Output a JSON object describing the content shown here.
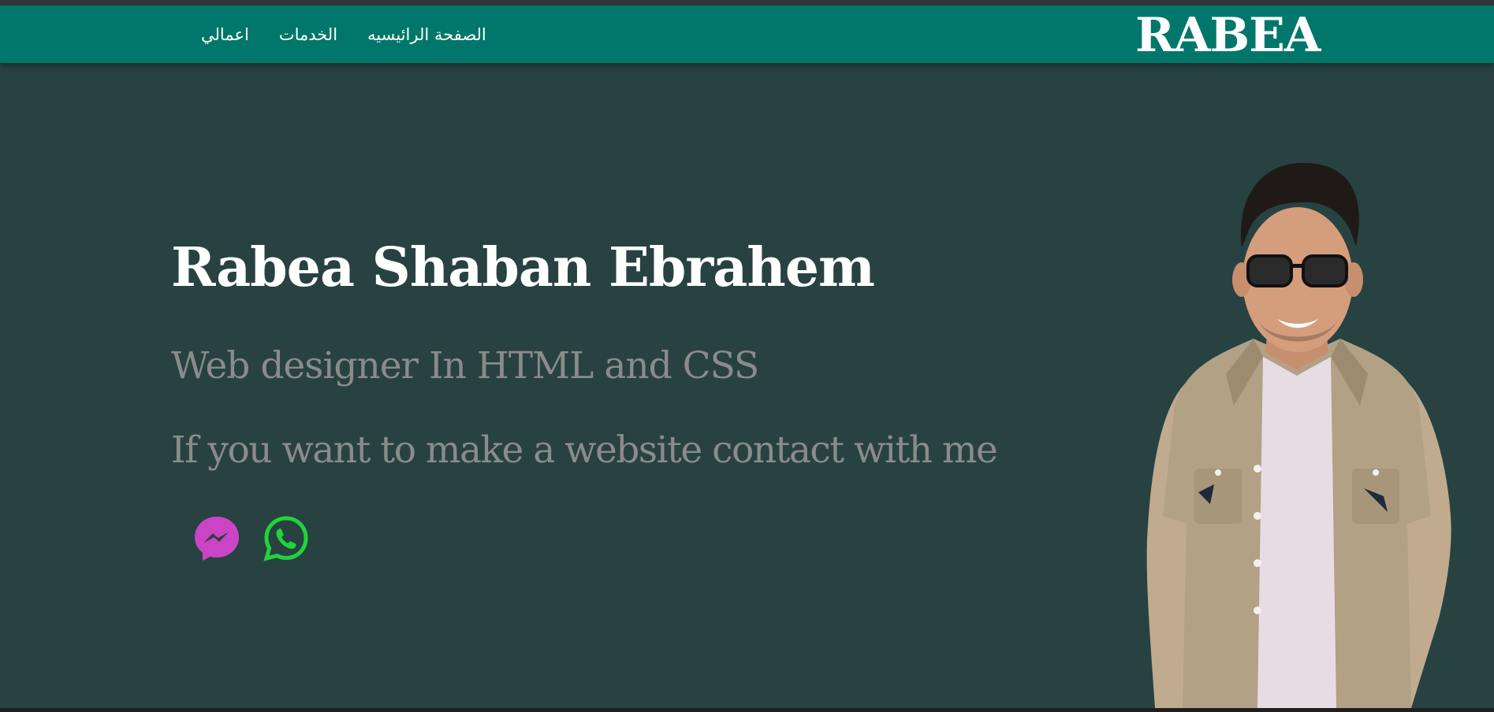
{
  "brand": {
    "name": "RABEA"
  },
  "nav": {
    "items": [
      {
        "label": "اعمالي"
      },
      {
        "label": "الخدمات"
      },
      {
        "label": "الصفحة الرائيسيه"
      }
    ]
  },
  "hero": {
    "name": "Rabea Shaban Ebrahem",
    "role": "Web designer In HTML and CSS",
    "cta": "If you want to make a website contact with me"
  },
  "social": [
    {
      "icon": "messenger-icon",
      "color": "#cc44c6"
    },
    {
      "icon": "whatsapp-icon",
      "color": "#22d33a"
    }
  ],
  "colors": {
    "navbar": "#00776a",
    "hero_background": "#284242",
    "heading_text": "#ffffff",
    "muted_text": "#8b8b8b"
  }
}
